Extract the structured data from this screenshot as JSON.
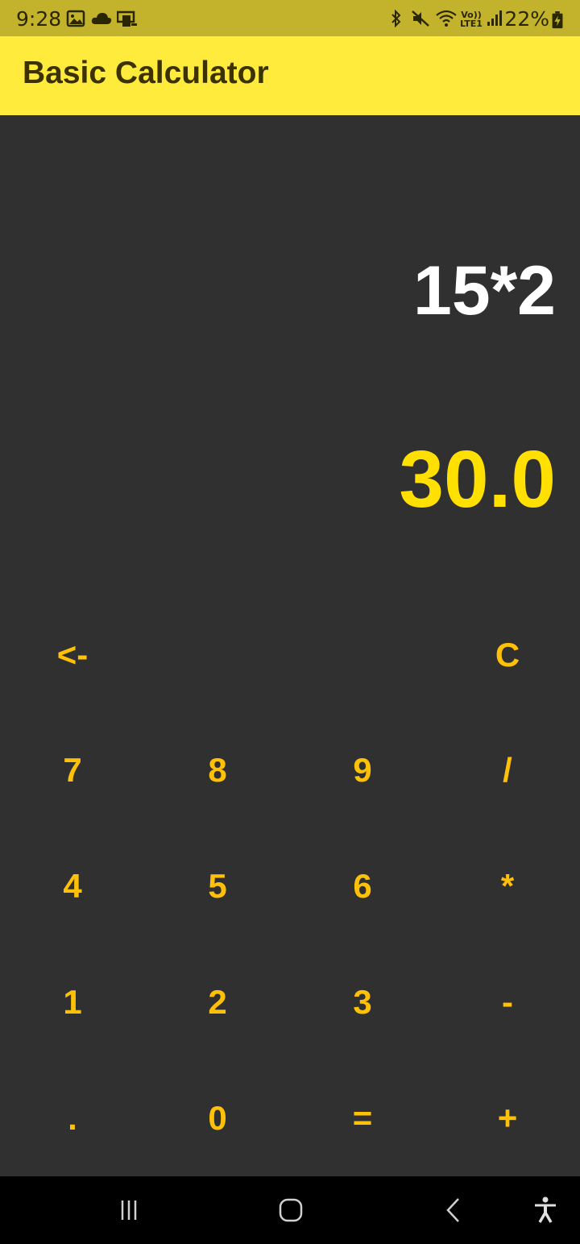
{
  "status_bar": {
    "time": "9:28",
    "battery": "22%",
    "network": "Vo)) LTE1",
    "icons": [
      "image-icon",
      "cloud-icon",
      "phone-link-icon",
      "bluetooth-icon",
      "mute-icon",
      "wifi-icon",
      "signal-icon",
      "battery-charging-icon"
    ]
  },
  "app_bar": {
    "title": "Basic Calculator",
    "color": "#ffeb3b"
  },
  "display": {
    "expression": "15*2",
    "result": "30.0",
    "expression_color": "#ffffff",
    "result_color": "#ffe000"
  },
  "keypad": {
    "row0": {
      "backspace": "<-",
      "clear": "C"
    },
    "row1": [
      "7",
      "8",
      "9",
      "/"
    ],
    "row2": [
      "4",
      "5",
      "6",
      "*"
    ],
    "row3": [
      "1",
      "2",
      "3",
      "-"
    ],
    "row4": [
      ".",
      "0",
      "=",
      "+"
    ],
    "key_color": "#ffc107"
  },
  "nav_bar": {
    "icons": [
      "recent-apps-icon",
      "home-icon",
      "back-icon",
      "accessibility-icon"
    ]
  }
}
